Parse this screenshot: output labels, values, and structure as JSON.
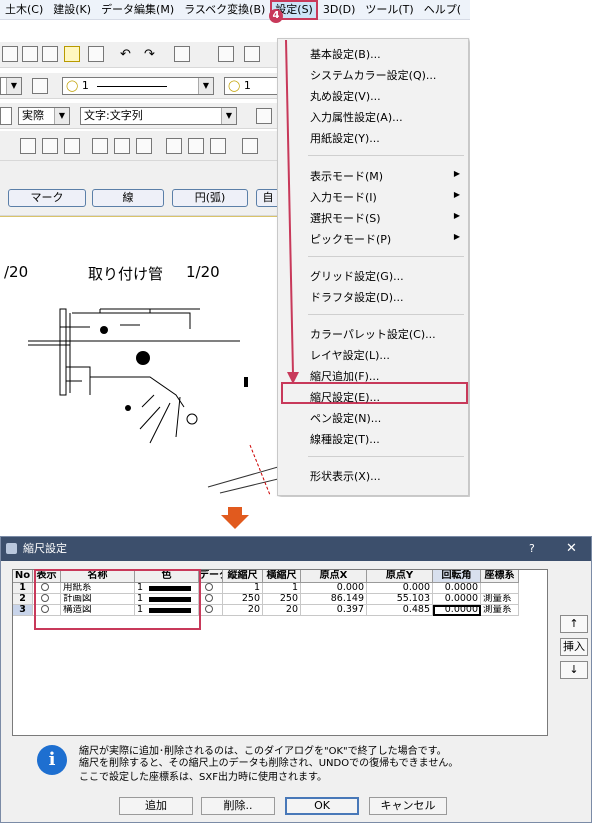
{
  "menubar": {
    "items": [
      "土木(C)",
      "建設(K)",
      "データ編集(M)",
      "ラスベク変換(B)",
      "設定(S)",
      "3D(D)",
      "ツール(T)",
      "ヘルプ("
    ],
    "active_badge": "4"
  },
  "toolbar": {
    "combo_color": "1",
    "combo_layer2": "1",
    "combo_scale": "実際",
    "combo_text": "文字:文字列",
    "tab_buttons": [
      "マーク",
      "線",
      "円(弧)",
      "自"
    ]
  },
  "drawing": {
    "scale_left": "/20",
    "title": "取り付け管",
    "title_scale": "1/20"
  },
  "settings_menu": {
    "items": [
      {
        "label": "基本設定(B)..."
      },
      {
        "label": "システムカラー設定(Q)..."
      },
      {
        "label": "丸め設定(V)..."
      },
      {
        "label": "入力属性設定(A)..."
      },
      {
        "label": "用紙設定(Y)..."
      },
      {
        "label": "表示モード(M)",
        "submenu": true
      },
      {
        "label": "入力モード(I)",
        "submenu": true
      },
      {
        "label": "選択モード(S)",
        "submenu": true
      },
      {
        "label": "ピックモード(P)",
        "submenu": true
      },
      {
        "label": "グリッド設定(G)..."
      },
      {
        "label": "ドラフタ設定(D)..."
      },
      {
        "label": "カラーパレット設定(C)..."
      },
      {
        "label": "レイヤ設定(L)..."
      },
      {
        "label": "縮尺追加(F)..."
      },
      {
        "label": "縮尺設定(E)..."
      },
      {
        "label": "ペン設定(N)..."
      },
      {
        "label": "線種設定(T)..."
      },
      {
        "label": "形状表示(X)..."
      }
    ],
    "submenu_glyph": "▶",
    "highlight_color": "#c8395a"
  },
  "dialog": {
    "title": "縮尺設定",
    "help": "?",
    "close": "✕",
    "columns": [
      "No",
      "表示",
      "名称",
      "色",
      "データ",
      "縦縮尺",
      "横縮尺",
      "原点X",
      "原点Y",
      "回転角",
      "座標系"
    ],
    "rows": [
      {
        "no": "1",
        "name": "用紙系",
        "color": "1",
        "v": "1",
        "h": "1",
        "ox": "0.000",
        "oy": "0.000",
        "rot": "0.0000",
        "coord": ""
      },
      {
        "no": "2",
        "name": "計画図",
        "color": "1",
        "v": "250",
        "h": "250",
        "ox": "86.149",
        "oy": "55.103",
        "rot": "0.0000",
        "coord": "測量系"
      },
      {
        "no": "3",
        "name": "構造図",
        "color": "1",
        "v": "20",
        "h": "20",
        "ox": "0.397",
        "oy": "0.485",
        "rot": "0.0000",
        "coord": "測量系"
      }
    ],
    "side_buttons": [
      "↑",
      "挿入",
      "↓"
    ],
    "messages": [
      "縮尺が実際に追加･削除されるのは、このダイアログを\"OK\"で終了した場合です。",
      "縮尺を削除すると、その縮尺上のデータも削除され、UNDOでの復帰もできません。",
      "ここで設定した座標系は、SXF出力時に使用されます。"
    ],
    "buttons": {
      "add": "追加",
      "delete": "削除..",
      "ok": "OK",
      "cancel": "キャンセル"
    }
  }
}
